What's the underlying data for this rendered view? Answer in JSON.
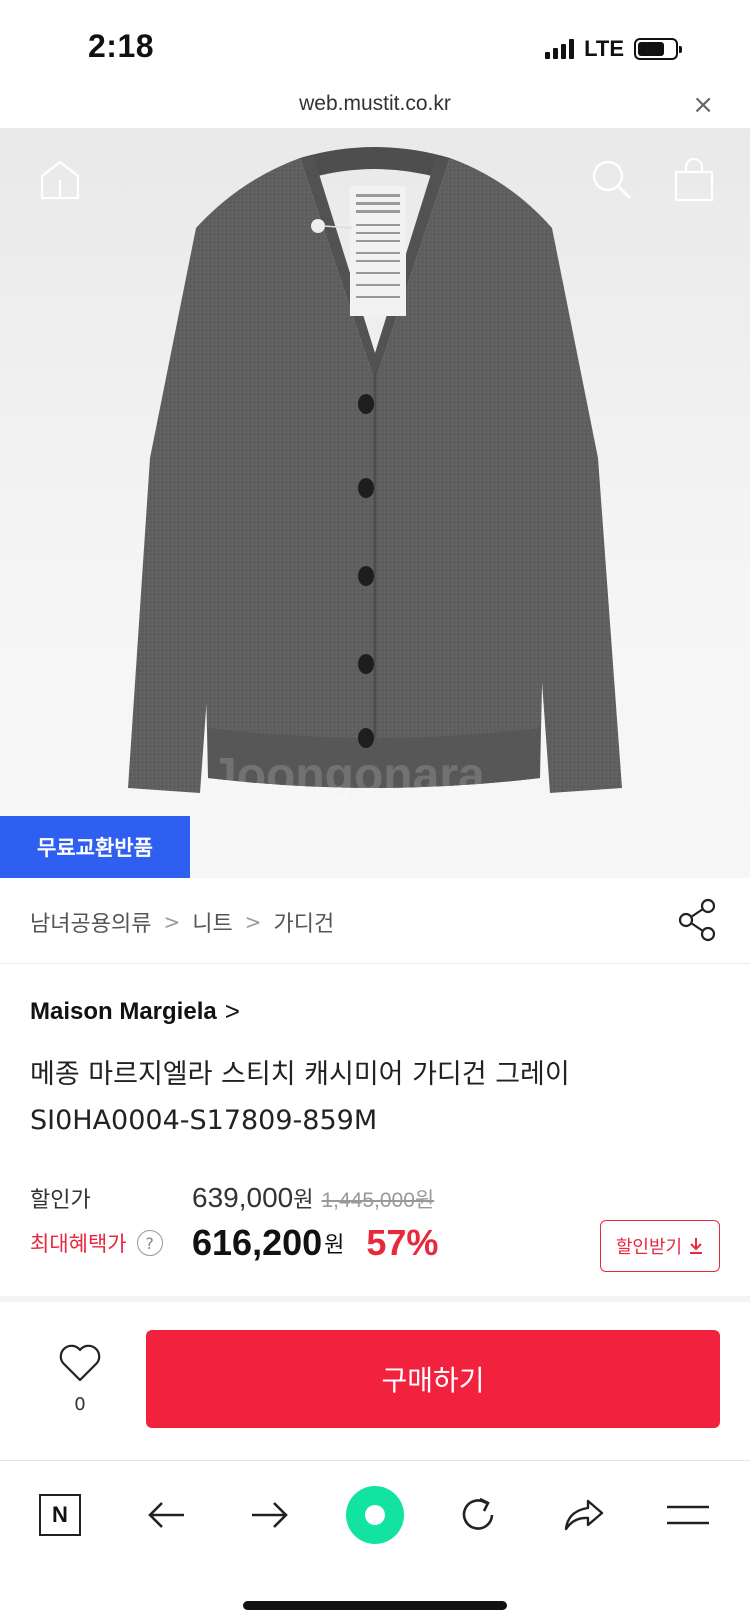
{
  "status_bar": {
    "time": "2:18",
    "network": "LTE",
    "battery_level": 0.72
  },
  "browser": {
    "url": "web.mustit.co.kr",
    "close_glyph": "×"
  },
  "product_image": {
    "badge": "무료교환반품",
    "watermark": "Joongonara"
  },
  "breadcrumb": {
    "items": [
      "남녀공용의류",
      "니트",
      "가디건"
    ],
    "separator": ">"
  },
  "product": {
    "brand": "Maison Margiela",
    "brand_arrow": ">",
    "name_line1": "메종 마르지엘라 스티치 캐시미어 가디건 그레이",
    "name_line2": "SI0HA0004-S17809-859M"
  },
  "pricing": {
    "sale_label": "할인가",
    "sale_price": "639,000",
    "currency": "원",
    "original_price": "1,445,000원",
    "benefit_label": "최대혜택가",
    "help_glyph": "?",
    "benefit_price": "616,200",
    "discount_rate": "57%",
    "coupon_button": "할인받기",
    "coupon_icon": "download-arrow"
  },
  "purchase": {
    "like_count": "0",
    "buy_label": "구매하기"
  },
  "toolbar": {
    "naver_letter": "N",
    "items": [
      "naver-home",
      "back",
      "forward",
      "green-dot",
      "reload",
      "share",
      "menu"
    ]
  },
  "colors": {
    "accent_red": "#f2223f",
    "badge_blue": "#2f5ff0",
    "green": "#12e3a0"
  }
}
